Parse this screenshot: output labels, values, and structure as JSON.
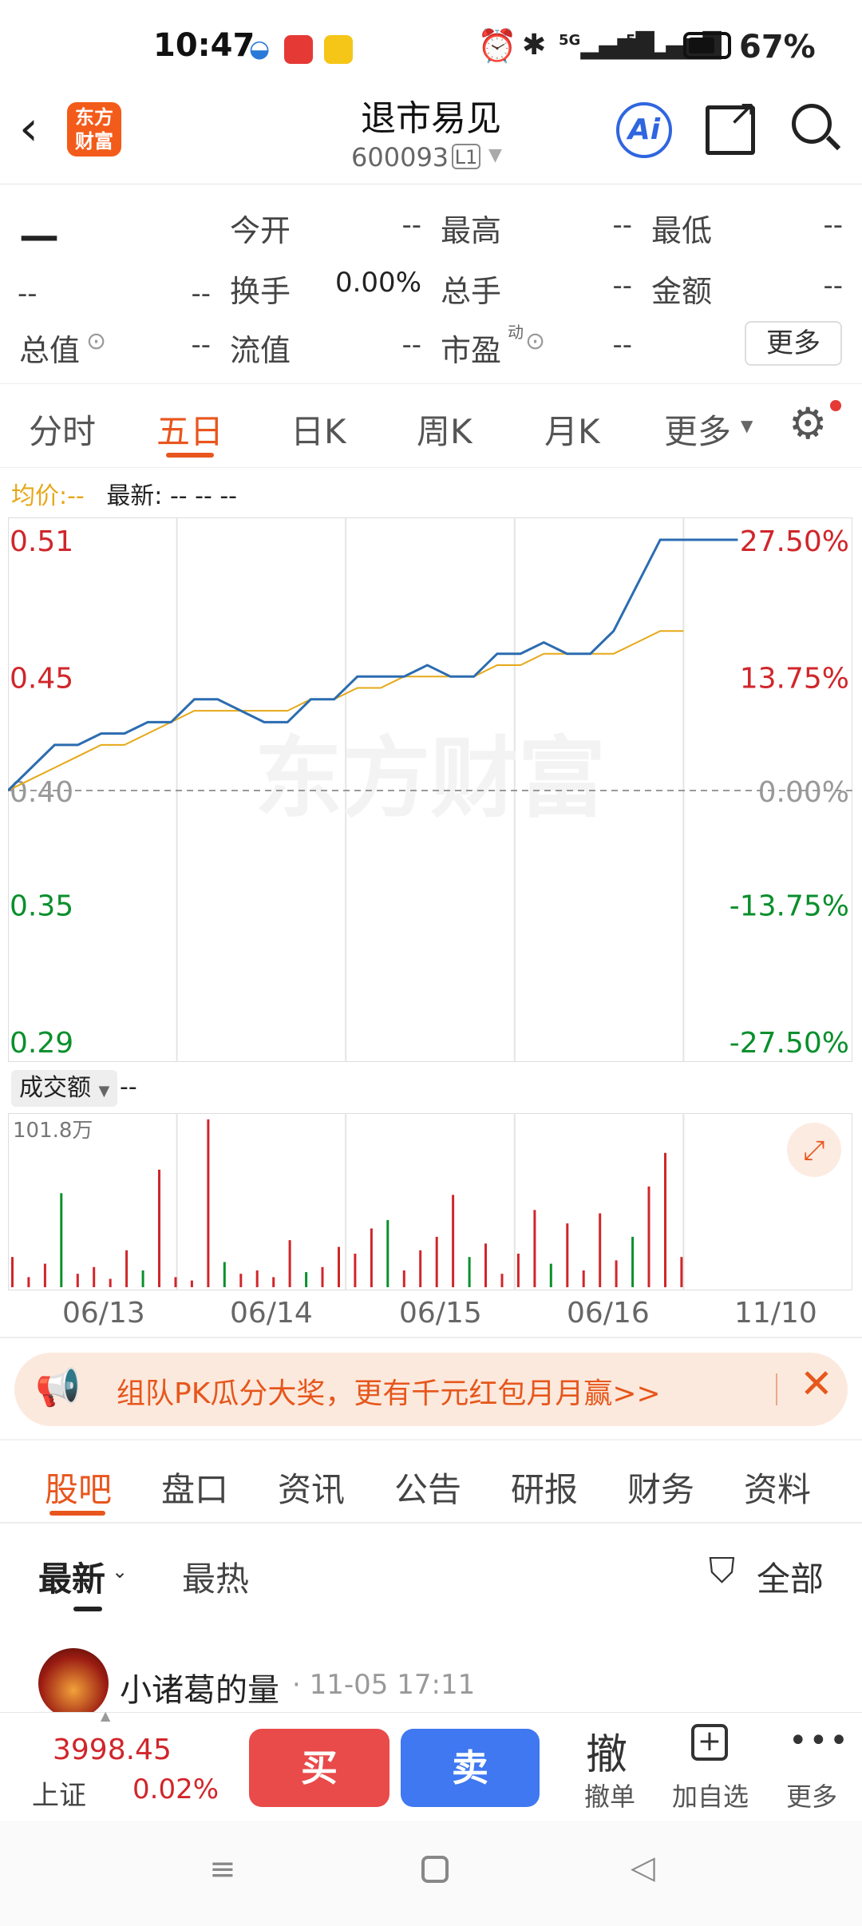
{
  "status_bar": {
    "time": "10:47",
    "battery_pct": "67%",
    "network": [
      "5G",
      "5G"
    ]
  },
  "header": {
    "logo_text": "东方\n财富",
    "title": "退市易见",
    "code": "600093",
    "level": "L1",
    "ai_label": "Ai"
  },
  "quote": {
    "price": "—",
    "change": "--",
    "change_pct": "--",
    "rows": [
      [
        {
          "label": "今开",
          "value": "--"
        },
        {
          "label": "最高",
          "value": "--"
        },
        {
          "label": "最低",
          "value": "--"
        }
      ],
      [
        {
          "label": "换手",
          "value": "0.00%"
        },
        {
          "label": "总手",
          "value": "--"
        },
        {
          "label": "金额",
          "value": "--"
        }
      ],
      [
        {
          "label": "流值",
          "value": "--"
        },
        {
          "label": "市盈",
          "value": "--"
        }
      ]
    ],
    "total_value_label": "总值",
    "total_value": "--",
    "pe_superscript": "动",
    "more_label": "更多"
  },
  "chart_tabs": {
    "items": [
      "分时",
      "五日",
      "日K",
      "周K",
      "月K",
      "更多"
    ],
    "active": "五日"
  },
  "legend": {
    "avg_label": "均价:",
    "avg_value": "--",
    "latest_label": "最新:",
    "latest_value": "-- -- --"
  },
  "watermark": "东方财富",
  "volume": {
    "selector": "成交额",
    "value": "--",
    "max_label": "101.8万"
  },
  "banner": {
    "text": "组队PK瓜分大奖，更有千元红包月月赢>>"
  },
  "bottom_tabs": {
    "items": [
      "股吧",
      "盘口",
      "资讯",
      "公告",
      "研报",
      "财务",
      "资料"
    ],
    "active": "股吧"
  },
  "sub_tabs": {
    "latest": "最新",
    "hot": "最热",
    "filter": "全部"
  },
  "post": {
    "author": "小诸葛的量",
    "time": "· 11-05 17:11"
  },
  "bottom_bar": {
    "index_value": "3998.45",
    "index_name": "上证",
    "index_change": "0.02%",
    "buy": "买",
    "sell": "卖",
    "cancel_icon": "撤",
    "cancel": "撤单",
    "add": "加自选",
    "more": "更多"
  },
  "colors": {
    "accent": "#e8561e",
    "up": "#d0262b",
    "down": "#0a8f2c",
    "line": "#2b6cb0",
    "avg": "#e6a817"
  },
  "chart_data": [
    {
      "type": "line",
      "title": "",
      "x_ticks": [
        "06/13",
        "06/14",
        "06/15",
        "06/16",
        "11/10"
      ],
      "y_left_ticks": [
        "0.51",
        "0.45",
        "0.40",
        "0.35",
        "0.29"
      ],
      "y_right_ticks": [
        "27.50%",
        "13.75%",
        "0.00%",
        "-13.75%",
        "-27.50%"
      ],
      "ylim": [
        0.29,
        0.51
      ],
      "reference": 0.4,
      "series": [
        {
          "values": [
            0.4,
            0.41,
            0.42,
            0.42,
            0.425,
            0.425,
            0.43,
            0.43,
            0.44,
            0.44,
            0.435,
            0.43,
            0.43,
            0.44,
            0.44,
            0.45,
            0.45,
            0.45,
            0.455,
            0.45,
            0.45,
            0.46,
            0.46,
            0.465,
            0.46,
            0.46,
            0.47,
            0.49,
            0.51,
            0.51
          ]
        },
        {
          "values": [
            0.4,
            0.405,
            0.41,
            0.415,
            0.42,
            0.42,
            0.425,
            0.43,
            0.435,
            0.435,
            0.435,
            0.435,
            0.435,
            0.44,
            0.44,
            0.445,
            0.445,
            0.45,
            0.45,
            0.45,
            0.45,
            0.455,
            0.455,
            0.46,
            0.46,
            0.46,
            0.46,
            0.465,
            0.47,
            0.47
          ]
        }
      ]
    },
    {
      "type": "bar",
      "title": "",
      "ylim": [
        0,
        101.8
      ],
      "values": [
        18,
        6,
        14,
        56,
        8,
        12,
        5,
        22,
        10,
        70,
        6,
        4,
        100,
        15,
        8,
        10,
        6,
        28,
        9,
        12,
        24,
        20,
        35,
        40,
        10,
        22,
        30,
        55,
        18,
        26,
        8,
        20,
        46,
        14,
        38,
        10,
        44,
        16,
        30,
        60,
        80,
        18
      ]
    }
  ]
}
